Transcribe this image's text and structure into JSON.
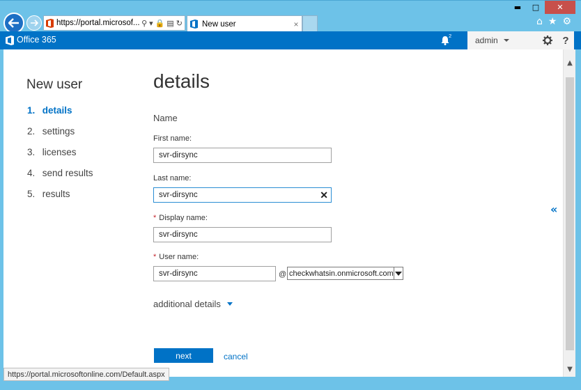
{
  "browser": {
    "address_url": "https://portal.microsof...",
    "tab_title": "New user",
    "tab_close": "×",
    "status_url": "https://portal.microsoftonline.com/Default.aspx"
  },
  "header": {
    "brand": "Office 365",
    "notification_count": "2",
    "user": "admin",
    "help": "?"
  },
  "wizard": {
    "title": "New user",
    "steps": [
      {
        "num": "1.",
        "label": "details",
        "active": true
      },
      {
        "num": "2.",
        "label": "settings",
        "active": false
      },
      {
        "num": "3.",
        "label": "licenses",
        "active": false
      },
      {
        "num": "4.",
        "label": "send results",
        "active": false
      },
      {
        "num": "5.",
        "label": "results",
        "active": false
      }
    ]
  },
  "form": {
    "heading": "details",
    "section": "Name",
    "first_name_label": "First name:",
    "first_name_value": "svr-dirsync",
    "last_name_label": "Last name:",
    "last_name_value": "svr-dirsync",
    "display_name_label": "Display name:",
    "display_name_value": "svr-dirsync",
    "user_name_label": "User name:",
    "user_name_value": "svr-dirsync",
    "required_marker": "*",
    "at": "@",
    "domain_value": "checkwhatsin.onmicrosoft.com",
    "additional_details": "additional details",
    "next_label": "next",
    "cancel_label": "cancel",
    "collapse": "«"
  },
  "colors": {
    "brand_blue": "#0072c6",
    "chrome_blue": "#6dc2e8",
    "required_red": "#c4262e"
  }
}
